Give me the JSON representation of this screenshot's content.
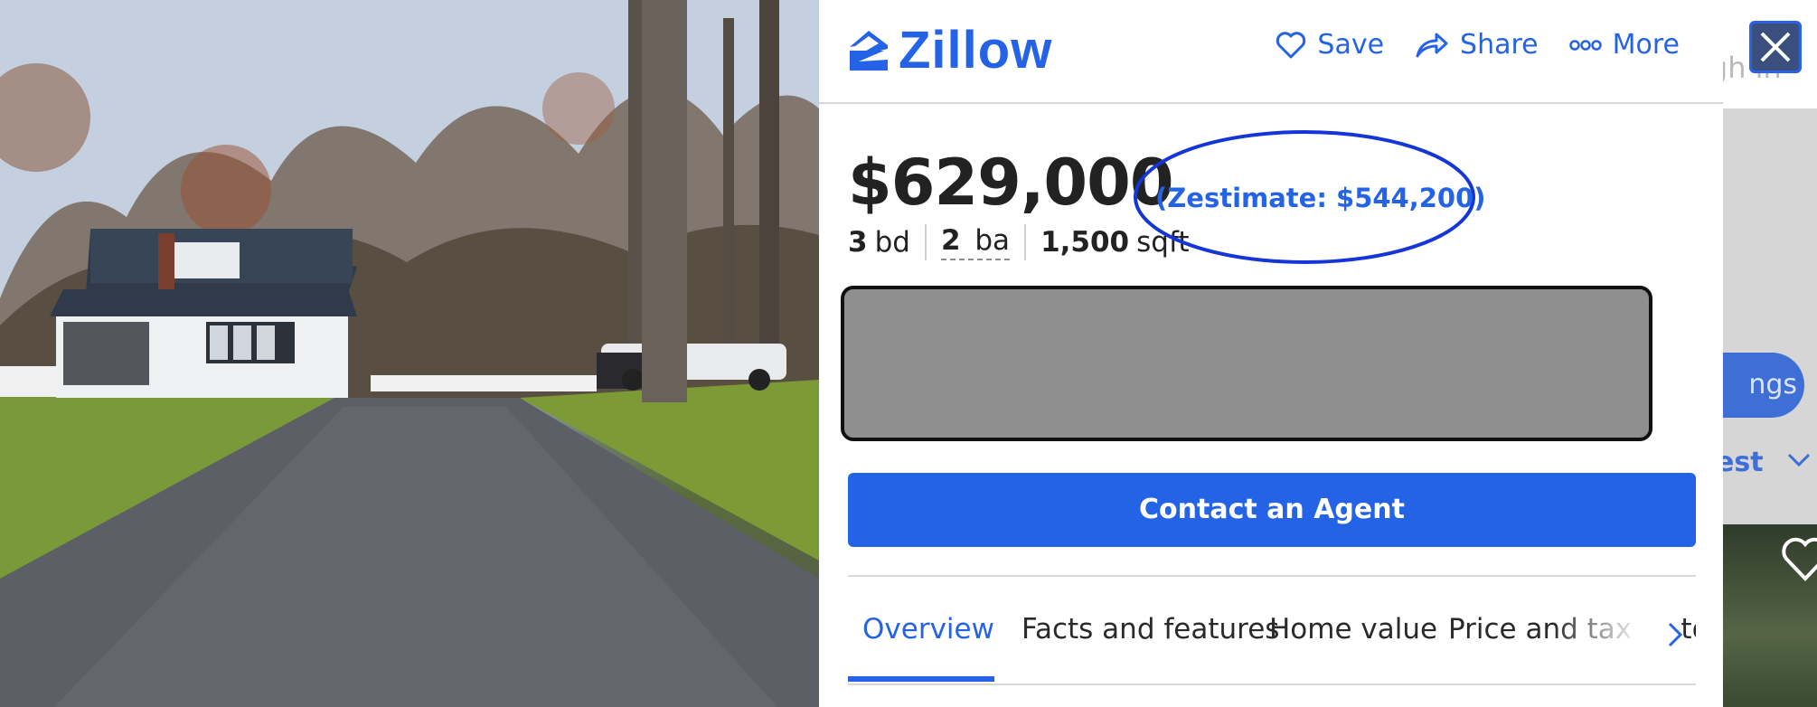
{
  "photo": {
    "alt": "Exterior photo of white house with gravel driveway"
  },
  "header": {
    "logo_text": "Zillow",
    "save_label": "Save",
    "share_label": "Share",
    "more_label": "More",
    "brand_color": "#2563e6"
  },
  "listing": {
    "price": "$629,000",
    "zestimate": "(Zestimate: $544,200)",
    "beds": "3",
    "beds_unit": "bd",
    "baths": "2",
    "baths_unit": "ba",
    "sqft": "1,500",
    "sqft_unit": "sqft"
  },
  "contact_label": "Contact an Agent",
  "tabs": [
    {
      "label": "Overview",
      "active": true
    },
    {
      "label": "Facts and features",
      "active": false
    },
    {
      "label": "Home value",
      "active": false
    },
    {
      "label": "Price and tax history",
      "active": false
    }
  ],
  "background_page": {
    "top_hint": "igh in",
    "button_label": "ngs",
    "sort_label": "est"
  },
  "icons": {
    "close": "close-icon",
    "save": "heart-icon",
    "share": "share-arrow-icon",
    "more": "more-dots-icon",
    "tab_next": "chevron-right-icon"
  }
}
